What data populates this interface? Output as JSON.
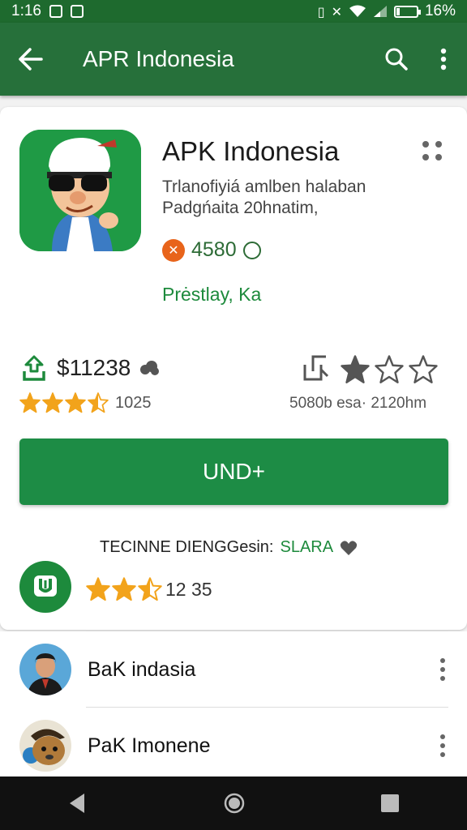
{
  "status_bar": {
    "time": "1:16",
    "battery": "16%",
    "battery_level": 0.16
  },
  "app_bar": {
    "title": "APR Indonesia",
    "icons": [
      "back-arrow-icon",
      "search-icon",
      "more-vert-icon"
    ]
  },
  "app": {
    "name": "APK Indonesia",
    "description_line1": "Trlanofiyiá amlben halaban",
    "description_line2": "Padgńaita 20hnatim,",
    "downloads": "4580",
    "developer": "Prėstlay, Ka"
  },
  "stats": {
    "price": "$11238",
    "rating_stars": 3.5,
    "rating_count": "1025",
    "size_info": "5080b esa·  2120hm",
    "review_stars": 1
  },
  "install_button": {
    "label": "UND+"
  },
  "promo": {
    "label": "TECINNE DIENGGesin:",
    "accent": "SLARA",
    "rating_stars": 2.5,
    "rating_text": "12  35"
  },
  "list": [
    {
      "name": "BaK indasia"
    },
    {
      "name": "PaK Imonene"
    }
  ],
  "colors": {
    "app_bar": "#26703a",
    "accent_green": "#1d8c45",
    "star_gold": "#f2a31b",
    "orange": "#e8641b"
  }
}
